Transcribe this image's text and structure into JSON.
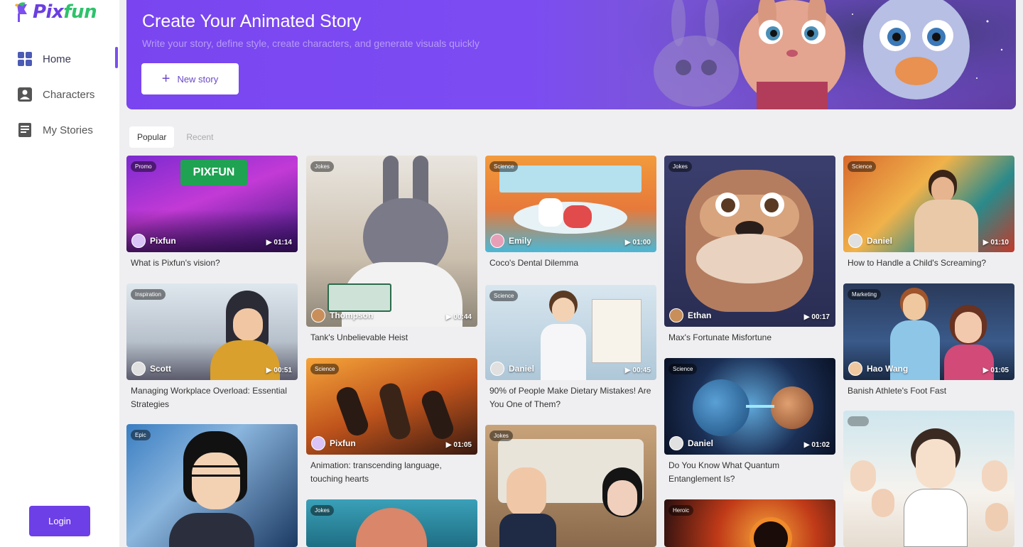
{
  "brand": {
    "name_a": "Pix",
    "name_b": "fun"
  },
  "nav": [
    {
      "label": "Home",
      "icon": "grid-icon"
    },
    {
      "label": "Characters",
      "icon": "person-card-icon"
    },
    {
      "label": "My Stories",
      "icon": "document-icon"
    }
  ],
  "login_label": "Login",
  "hero": {
    "title": "Create Your Animated Story",
    "subtitle": "Write your story, define style, create characters, and generate visuals quickly",
    "button_label": "New story"
  },
  "tabs": [
    "Popular",
    "Recent"
  ],
  "cards": [
    {
      "tag": "Promo",
      "author": "Pixfun",
      "duration": "01:14",
      "title": "What is Pixfun's vision?"
    },
    {
      "tag": "Inspiration",
      "author": "Scott",
      "duration": "00:51",
      "title": "Managing Workplace Overload: Essential Strategies"
    },
    {
      "tag": "Epic",
      "author": "",
      "duration": "",
      "title": ""
    },
    {
      "tag": "Jokes",
      "author": "Thompson",
      "duration": "00:44",
      "title": "Tank's Unbelievable Heist"
    },
    {
      "tag": "Science",
      "author": "Pixfun",
      "duration": "01:05",
      "title": "Animation:  transcending language, touching hearts"
    },
    {
      "tag": "Jokes",
      "author": "",
      "duration": "",
      "title": ""
    },
    {
      "tag": "Science",
      "author": "Emily",
      "duration": "01:00",
      "title": "Coco's Dental Dilemma"
    },
    {
      "tag": "Science",
      "author": "Daniel",
      "duration": "00:45",
      "title": "90% of People Make Dietary Mistakes! Are You One of Them?"
    },
    {
      "tag": "Jokes",
      "author": "",
      "duration": "",
      "title": ""
    },
    {
      "tag": "Jokes",
      "author": "Ethan",
      "duration": "00:17",
      "title": "Max's Fortunate Misfortune"
    },
    {
      "tag": "Science",
      "author": "Daniel",
      "duration": "01:02",
      "title": "Do You Know What Quantum Entanglement Is?"
    },
    {
      "tag": "Heroic",
      "author": "",
      "duration": "",
      "title": ""
    },
    {
      "tag": "Science",
      "author": "Daniel",
      "duration": "01:10",
      "title": "How to Handle a Child's Screaming?"
    },
    {
      "tag": "Marketing",
      "author": "Hao Wang",
      "duration": "01:05",
      "title": "Banish Athlete's Foot Fast"
    },
    {
      "tag": "",
      "author": "",
      "duration": "",
      "title": ""
    }
  ]
}
